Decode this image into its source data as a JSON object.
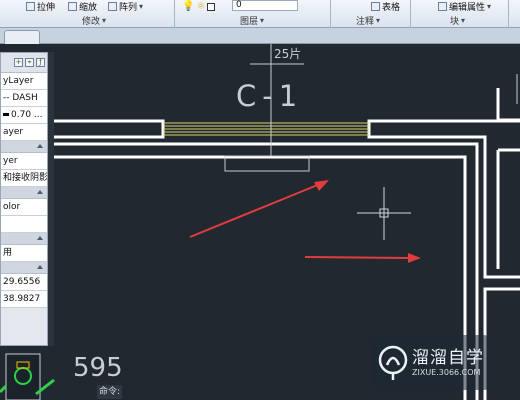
{
  "ribbon": {
    "row1": {
      "stretch_label": "拉伸",
      "scale_label": "缩放",
      "array_label": "阵列",
      "layer_value": "0",
      "table_label": "表格",
      "edit_attr_label": "编辑属性"
    },
    "groups": {
      "modify": "修改",
      "layers": "图层",
      "annotation": "注释",
      "block": "块"
    }
  },
  "palette": {
    "rows": [
      "yLayer",
      "-- DASH",
      "0.70 ...",
      "ayer",
      "",
      "yer",
      "和接收阴影",
      "olor",
      "",
      "用",
      "29.6556",
      "38.9827"
    ]
  },
  "drawing": {
    "top_label": "25片",
    "grid_label": "C-1",
    "bottom_left_label": "595"
  },
  "command": {
    "label": "命令:"
  },
  "watermark": {
    "title": "溜溜自学",
    "url": "ZIXUE.3066.COM"
  },
  "colors": {
    "canvas_bg": "#212830",
    "wall_line": "#ffffff",
    "hatch_line": "#d8d46a",
    "arrow": "#e23c3c",
    "thin_line": "#c9ccd1",
    "palette_green": "#2cd04a"
  }
}
